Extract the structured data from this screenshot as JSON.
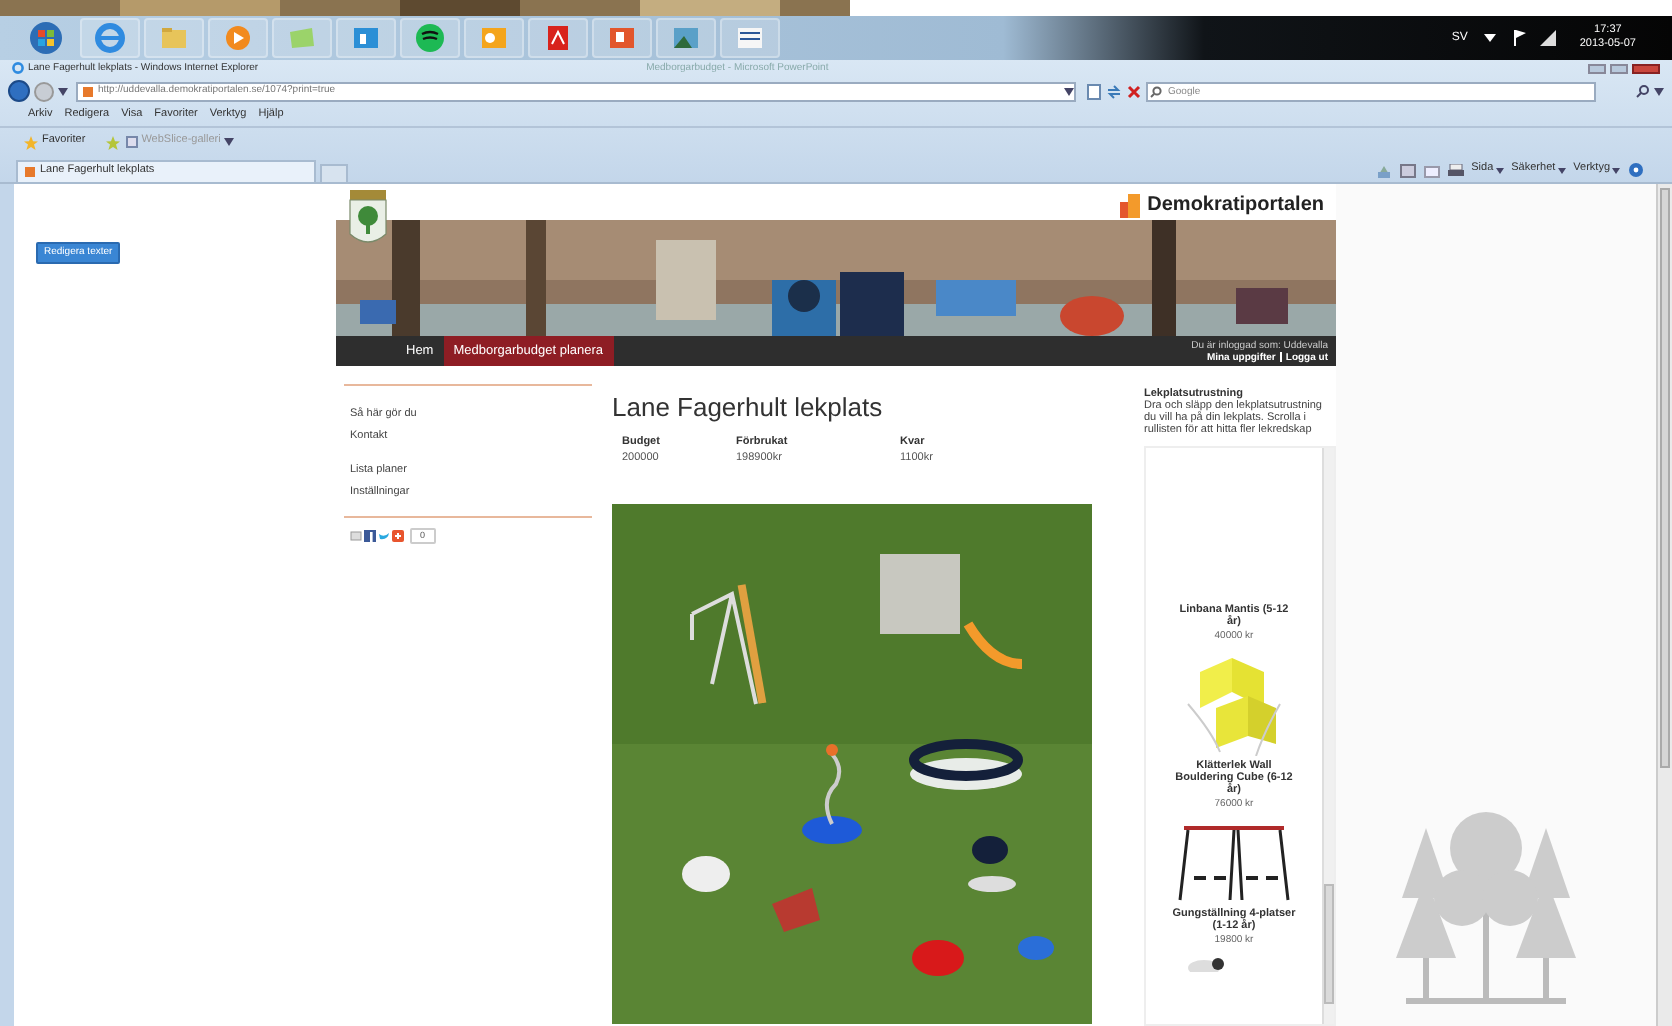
{
  "taskbar": {
    "apps": [
      {
        "kind": "start"
      },
      {
        "kind": "browser"
      },
      {
        "kind": "folder"
      },
      {
        "kind": "media"
      },
      {
        "kind": "notes"
      },
      {
        "kind": "lync"
      },
      {
        "kind": "music"
      },
      {
        "kind": "outlook"
      },
      {
        "kind": "pdf"
      },
      {
        "kind": "powerpoint"
      },
      {
        "kind": "photos"
      },
      {
        "kind": "word"
      }
    ],
    "language": "SV",
    "time": "17:37",
    "date": "2013-05-07"
  },
  "window": {
    "title": "Lane Fagerhult lekplats - Windows Internet Explorer",
    "background_title": "Medborgarbudget - Microsoft PowerPoint"
  },
  "address_bar": {
    "url": "http://uddevalla.demokratiportalen.se/1074?print=true",
    "search_placeholder": "Google"
  },
  "menu": [
    "Arkiv",
    "Redigera",
    "Visa",
    "Favoriter",
    "Verktyg",
    "Hjälp"
  ],
  "favorites_bar": {
    "favorites": "Favoriter",
    "webslice": "WebSlice-galleri"
  },
  "tabs": [
    {
      "label": "Lane Fagerhult lekplats",
      "selected": true
    }
  ],
  "command_bar": [
    "Sida",
    "Säkerhet",
    "Verktyg"
  ],
  "edit_button": "Redigera texter",
  "site": {
    "brand": "Demokratiportalen",
    "nav": [
      {
        "label": "Hem",
        "selected": false
      },
      {
        "label": "Medborgarbudget planera",
        "selected": true
      }
    ],
    "login_status": "Du är inloggad som: Uddevalla",
    "account_links": [
      "Mina uppgifter",
      "Logga ut"
    ]
  },
  "sidebar": {
    "groups": [
      [
        "Så här gör du",
        "Kontakt"
      ],
      [
        "Lista planer",
        "Inställningar"
      ]
    ],
    "share_count": "0"
  },
  "plan": {
    "title": "Lane Fagerhult lekplats",
    "stats": [
      {
        "label": "Budget",
        "value": "200000"
      },
      {
        "label": "Förbrukat",
        "value": "198900kr"
      },
      {
        "label": "Kvar",
        "value": "1100kr"
      }
    ]
  },
  "equipment_panel": {
    "title": "Lekplatsutrustning",
    "instructions": "Dra och släpp den lekplatsutrustning du vill ha på din lekplats. Scrolla i rullisten för att hitta fler lekredskap",
    "items": [
      {
        "name": "Linbana Mantis (5-12 år)",
        "price": "40000 kr",
        "kind": "none"
      },
      {
        "name": "Klätterlek Wall Bouldering Cube (6-12 år)",
        "price": "76000 kr",
        "kind": "cube"
      },
      {
        "name": "Gungställning 4-platser (1-12 år)",
        "price": "19800 kr",
        "kind": "swing"
      },
      {
        "kind": "animal"
      }
    ]
  }
}
